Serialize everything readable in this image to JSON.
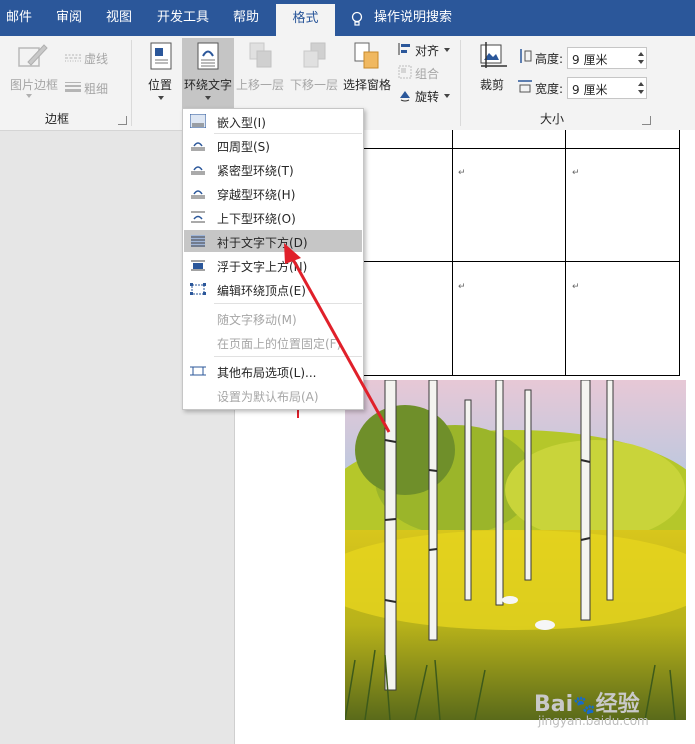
{
  "tabs": [
    "邮件",
    "审阅",
    "视图",
    "开发工具",
    "帮助",
    "格式"
  ],
  "tell_me": "操作说明搜索",
  "ribbon": {
    "border_group": {
      "picture_border": "图片边框",
      "dashes": "虚线",
      "weight": "粗细",
      "group_label": "边框"
    },
    "arrange": {
      "position": "位置",
      "wrap_text": "环绕文字",
      "bring_forward": "上移一层",
      "send_backward": "下移一层",
      "selection_pane": "选择窗格",
      "align": "对齐",
      "group": "组合",
      "rotate": "旋转"
    },
    "size": {
      "crop": "裁剪",
      "height_label": "高度:",
      "height_value": "9 厘米",
      "width_label": "宽度:",
      "width_value": "9 厘米",
      "group_label": "大小"
    }
  },
  "wrap_menu": [
    {
      "label": "嵌入型(I)",
      "enabled": true
    },
    {
      "label": "四周型(S)",
      "enabled": true
    },
    {
      "label": "紧密型环绕(T)",
      "enabled": true
    },
    {
      "label": "穿越型环绕(H)",
      "enabled": true
    },
    {
      "label": "上下型环绕(O)",
      "enabled": true
    },
    {
      "label": "衬于文字下方(D)",
      "enabled": true,
      "highlighted": true
    },
    {
      "label": "浮于文字上方(N)",
      "enabled": true
    },
    {
      "label": "编辑环绕顶点(E)",
      "enabled": true
    },
    {
      "label": "随文字移动(M)",
      "enabled": false
    },
    {
      "label": "在页面上的位置固定(F)",
      "enabled": false
    },
    {
      "label": "其他布局选项(L)...",
      "enabled": true
    },
    {
      "label": "设置为默认布局(A)",
      "enabled": false
    }
  ],
  "document": {
    "paragraph_mark": "↵"
  },
  "watermark": {
    "brand": "Bai",
    "brand_suffix": "经验",
    "url": "jingyan.baidu.com"
  },
  "colors": {
    "tab_bar": "#2b579a",
    "ribbon_bg": "#f3f3f3",
    "menu_highlight": "#c6c6c6",
    "arrow": "#e0202a"
  }
}
